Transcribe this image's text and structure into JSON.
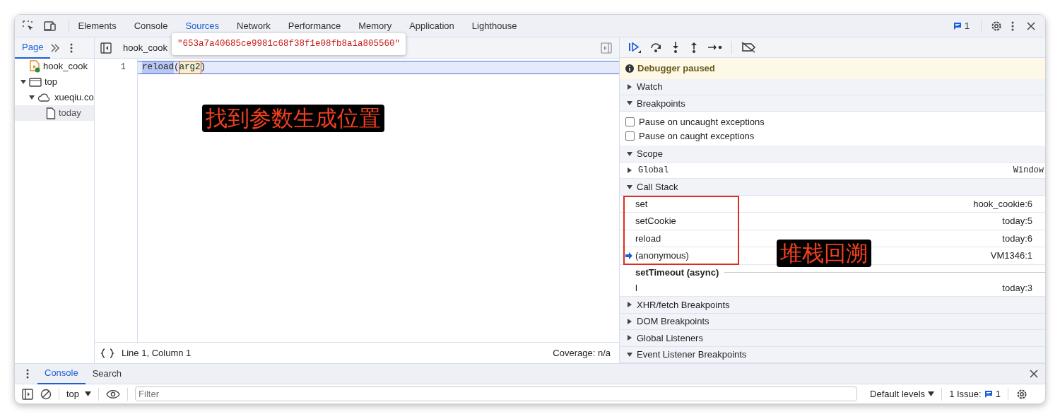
{
  "main_tabs": [
    {
      "label": "Elements",
      "selected": false
    },
    {
      "label": "Console",
      "selected": false
    },
    {
      "label": "Sources",
      "selected": true
    },
    {
      "label": "Network",
      "selected": false
    },
    {
      "label": "Performance",
      "selected": false
    },
    {
      "label": "Memory",
      "selected": false
    },
    {
      "label": "Application",
      "selected": false
    },
    {
      "label": "Lighthouse",
      "selected": false
    }
  ],
  "issues_count": "1",
  "navigator": {
    "tabs": [
      {
        "label": "Page",
        "selected": true
      }
    ],
    "tree": [
      {
        "label": "hook_cook",
        "kind": "script",
        "selected": false
      },
      {
        "label": "top",
        "kind": "frame",
        "selected": false,
        "expanded": true,
        "children": [
          {
            "label": "xueqiu.co",
            "kind": "domain",
            "selected": false,
            "expanded": true,
            "children": [
              {
                "label": "today",
                "kind": "file",
                "selected": true
              }
            ]
          }
        ]
      }
    ]
  },
  "editor": {
    "tab": "hook_cook",
    "tooltip": "\"653a7a40685ce9981c68f38f1e08fb8a1a805560\"",
    "lines": [
      {
        "number": "1",
        "tokens": [
          {
            "text": "reload",
            "kind": "selected"
          },
          {
            "text": "(",
            "kind": "plain"
          },
          {
            "text": "arg2",
            "kind": "hovered"
          },
          {
            "text": ")",
            "kind": "plain"
          }
        ]
      }
    ],
    "position": "Line 1, Column 1",
    "coverage": "Coverage: n/a",
    "annotation": "找到参数生成位置"
  },
  "debugger": {
    "banner": "Debugger paused",
    "sections": [
      {
        "kind": "plain",
        "title": "Watch",
        "expanded": false
      },
      {
        "kind": "checkboxes",
        "title": "Breakpoints",
        "expanded": true,
        "items": [
          {
            "label": "Pause on uncaught exceptions",
            "checked": false
          },
          {
            "label": "Pause on caught exceptions",
            "checked": false
          }
        ]
      },
      {
        "kind": "scope",
        "title": "Scope",
        "expanded": true,
        "items": [
          {
            "name": "Global",
            "value": "Window"
          }
        ]
      },
      {
        "kind": "stack",
        "title": "Call Stack",
        "expanded": true,
        "frames": [
          {
            "name": "set",
            "location": "hook_cookie:6",
            "selected": false
          },
          {
            "name": "setCookie",
            "location": "today:5",
            "selected": false
          },
          {
            "name": "reload",
            "location": "today:6",
            "selected": false
          },
          {
            "name": "(anonymous)",
            "location": "VM1346:1",
            "selected": true
          }
        ],
        "async_label": "setTimeout (async)",
        "async_frames": [
          {
            "name": "l",
            "location": "today:3",
            "selected": false
          }
        ],
        "annotation": "堆栈回溯"
      },
      {
        "kind": "plain",
        "title": "XHR/fetch Breakpoints",
        "expanded": false
      },
      {
        "kind": "plain",
        "title": "DOM Breakpoints",
        "expanded": false
      },
      {
        "kind": "plain",
        "title": "Global Listeners",
        "expanded": false
      },
      {
        "kind": "plain",
        "title": "Event Listener Breakpoints",
        "expanded": true
      }
    ]
  },
  "drawer": {
    "tabs": [
      {
        "label": "Console",
        "selected": true
      },
      {
        "label": "Search",
        "selected": false
      }
    ],
    "context": "top",
    "filter_placeholder": "Filter",
    "levels": "Default levels",
    "issues_label": "1 Issue:",
    "issues_count": "1"
  }
}
